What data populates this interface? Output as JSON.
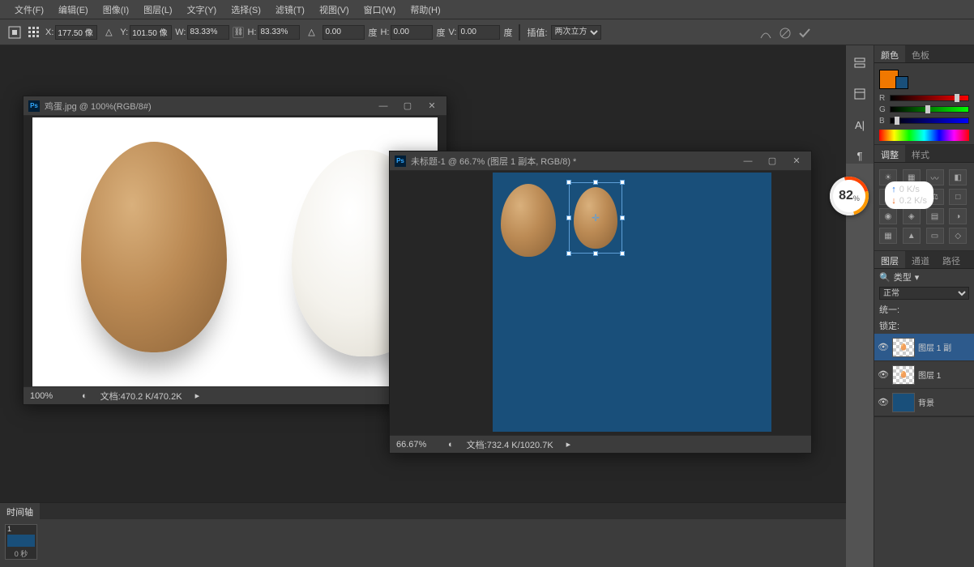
{
  "menu": {
    "file": "文件(F)",
    "edit": "编辑(E)",
    "image": "图像(I)",
    "layer": "图层(L)",
    "type": "文字(Y)",
    "select": "选择(S)",
    "filter": "滤镜(T)",
    "view": "视图(V)",
    "window": "窗口(W)",
    "help": "帮助(H)"
  },
  "options": {
    "x": "177.50 像",
    "y": "101.50 像",
    "w": "83.33%",
    "h": "83.33%",
    "angle": "0.00",
    "degree1": "度",
    "hskew": "0.00",
    "degree2": "度",
    "vskew": "0.00",
    "degree3": "度",
    "interp_label": "插值:",
    "interp_value": "两次立方"
  },
  "win1": {
    "title": "鸡蛋.jpg @ 100%(RGB/8#)",
    "zoom": "100%",
    "docinfo": "文档:470.2 K/470.2K"
  },
  "win2": {
    "title": "未标题-1 @ 66.7% (图层 1 副本, RGB/8) *",
    "zoom": "66.67%",
    "docinfo": "文档:732.4 K/1020.7K"
  },
  "color_panel": {
    "tab1": "颜色",
    "tab2": "色板",
    "r": "R",
    "g": "G",
    "b": "B"
  },
  "adjust_panel": {
    "tab1": "调整",
    "tab2": "样式"
  },
  "layers_panel": {
    "tab1": "图层",
    "tab2": "通道",
    "tab3": "路径",
    "kind": "类型",
    "blend": "正常",
    "unify": "统一:",
    "lock": "锁定:",
    "layer1": "图层 1 副",
    "layer2": "图层 1",
    "layer3": "背景"
  },
  "timeline": {
    "tab": "时间轴",
    "frame_num": "1",
    "frame_time": "0 秒"
  },
  "net": {
    "pct": "82",
    "pct_sym": "%",
    "up": "0 K/s",
    "down": "0.2 K/s"
  }
}
